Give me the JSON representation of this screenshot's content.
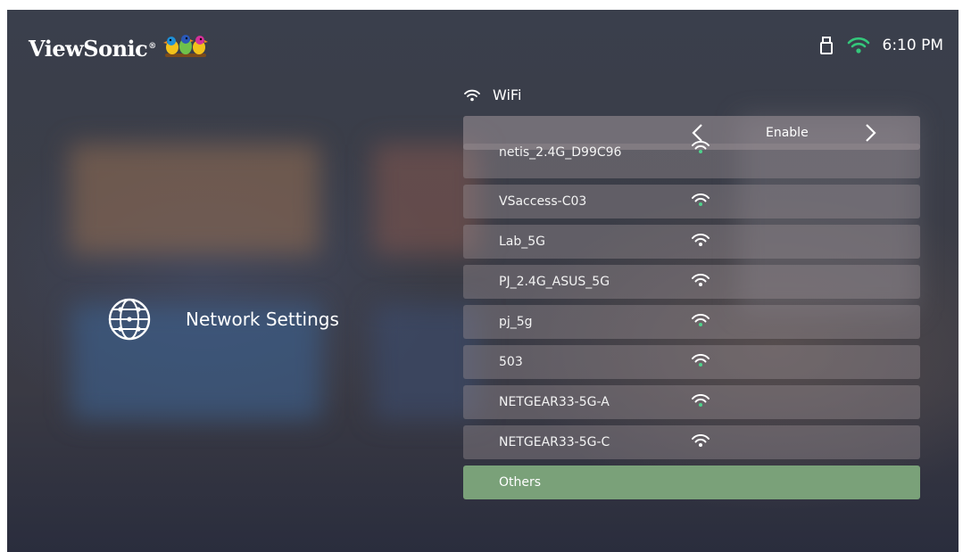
{
  "header": {
    "brand": "ViewSonic",
    "brand_mark": "®",
    "time": "6:10 PM"
  },
  "status_icons": [
    "usb-drive-icon",
    "wifi-connected-icon"
  ],
  "wifi_section": {
    "title": "WiFi",
    "icon": "wifi-icon"
  },
  "category": {
    "label": "Network Settings",
    "icon": "globe-network-icon"
  },
  "wifi_toggle": {
    "value": "Enable",
    "prev_icon": "chevron-left-icon",
    "next_icon": "chevron-right-icon"
  },
  "networks": [
    {
      "ssid": "netis_2.4G_D99C96"
    },
    {
      "ssid": "VSaccess-C03"
    },
    {
      "ssid": "Lab_5G"
    },
    {
      "ssid": "PJ_2.4G_ASUS_5G"
    },
    {
      "ssid": "pj_5g"
    },
    {
      "ssid": "503"
    },
    {
      "ssid": "NETGEAR33-5G-A"
    },
    {
      "ssid": "NETGEAR33-5G-C"
    }
  ],
  "others_label": "Others",
  "colors": {
    "selected": "#7aa179",
    "signal": "#4fd18b",
    "status_wifi": "#34c77b"
  }
}
